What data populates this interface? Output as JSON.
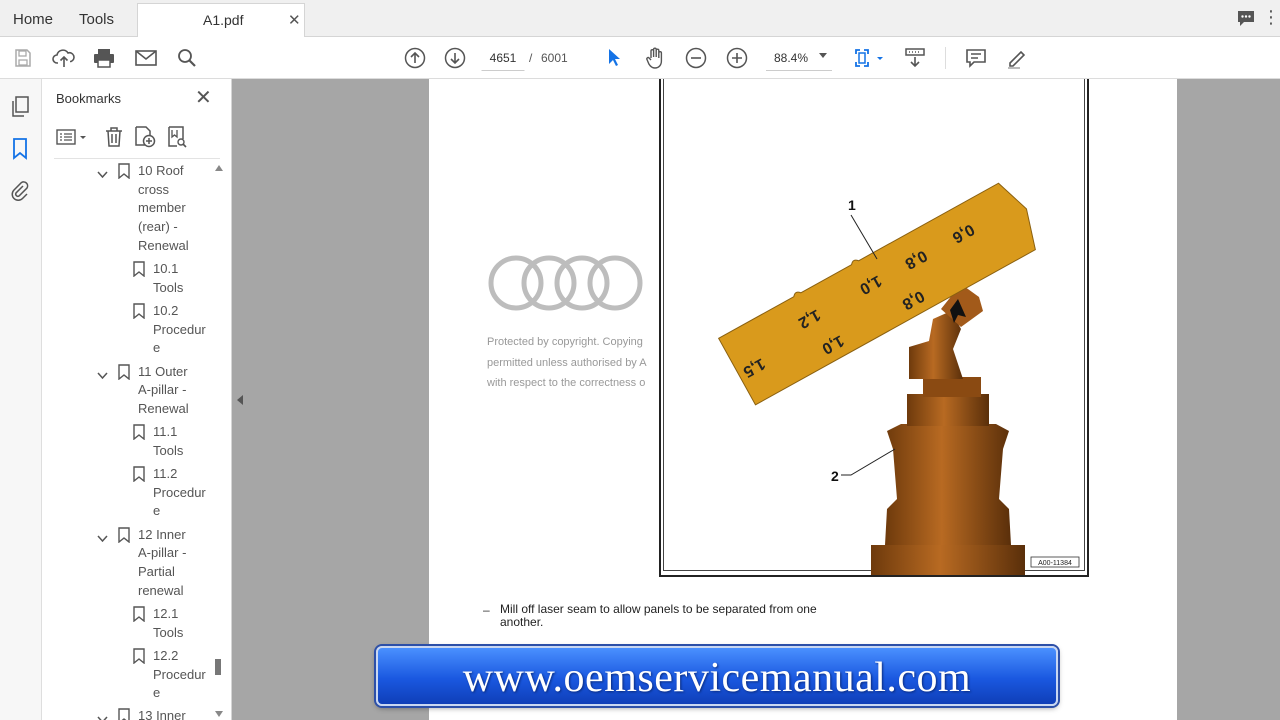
{
  "tabs": {
    "home": "Home",
    "tools": "Tools",
    "document": "A1.pdf",
    "close": "✕"
  },
  "toolbar": {
    "current_page": "4651",
    "page_separator": "/",
    "total_pages": "6001",
    "zoom": "88.4%",
    "icons": [
      "save-icon",
      "upload-icon",
      "print-icon",
      "email-icon",
      "search-icon",
      "page-up-icon",
      "page-down-icon",
      "select-cursor-icon",
      "hand-tool-icon",
      "zoom-out-icon",
      "zoom-in-icon",
      "fit-page-icon",
      "scroll-mode-icon",
      "comment-icon",
      "highlight-pen-icon"
    ]
  },
  "sidebar": {
    "title": "Bookmarks",
    "close": "✕",
    "bookmarks": [
      {
        "label": "10 Roof cross member (rear) - Renewal",
        "lines": [
          "10 Roof",
          "cross",
          "member",
          "(rear) -",
          "Renewal"
        ],
        "expanded": true,
        "level": 1
      },
      {
        "label": "10.1 Tools",
        "lines": [
          "10.1",
          "Tools"
        ],
        "level": 2
      },
      {
        "label": "10.2 Procedure",
        "lines": [
          "10.2",
          "Procedur",
          "e"
        ],
        "level": 2
      },
      {
        "label": "11 Outer A-pillar - Renewal",
        "lines": [
          "11 Outer",
          "A-pillar -",
          "Renewal"
        ],
        "expanded": true,
        "level": 1
      },
      {
        "label": "11.1 Tools",
        "lines": [
          "11.1",
          "Tools"
        ],
        "level": 2
      },
      {
        "label": "11.2 Procedure",
        "lines": [
          "11.2",
          "Procedur",
          "e"
        ],
        "level": 2
      },
      {
        "label": "12 Inner A-pillar - Partial renewal",
        "lines": [
          "12 Inner",
          "A-pillar -",
          "Partial",
          "renewal"
        ],
        "expanded": true,
        "level": 1
      },
      {
        "label": "12.1 Tools",
        "lines": [
          "12.1",
          "Tools"
        ],
        "level": 2
      },
      {
        "label": "12.2 Procedure",
        "lines": [
          "12.2",
          "Procedur",
          "e"
        ],
        "level": 2
      },
      {
        "label": "13 Inner",
        "lines": [
          "13 Inner"
        ],
        "expanded": true,
        "level": 1
      }
    ]
  },
  "document": {
    "copyright_lines": [
      "Protected by copyright. Copying",
      "permitted unless authorised by A",
      "with respect to the correctness o"
    ],
    "figure": {
      "callout_1": "1",
      "callout_2": "2",
      "gauge_marks": [
        "1,5",
        "1,2",
        "1,0",
        "1,0",
        "0,8",
        "0,8",
        "0,6"
      ],
      "figure_id": "A00-11384"
    },
    "step_dash": "–",
    "step_text": "Mill off laser seam to allow panels to be separated from one another."
  },
  "banner": {
    "text": "www.oemservicemanual.com"
  },
  "colors": {
    "gauge": "#d99a1c",
    "tool_body": "#9a5316",
    "banner_blue": "#1a58e0",
    "viewer_bg": "#a6a6a6",
    "accent_blue": "#1473e6"
  }
}
